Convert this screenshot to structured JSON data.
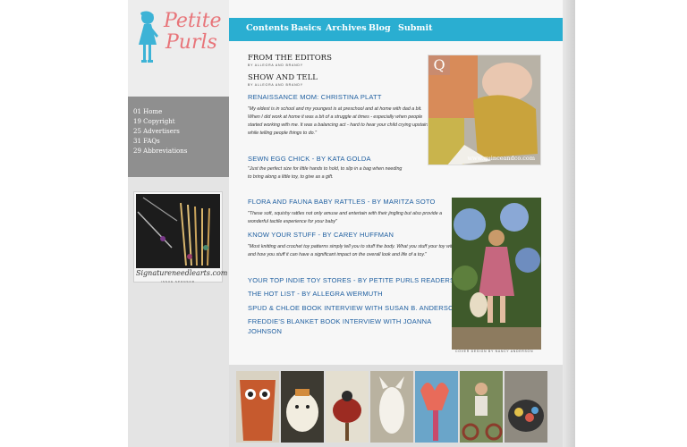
{
  "logo": {
    "line1": "Petite",
    "line2": "Purls"
  },
  "issue_menu": [
    "01 Home",
    "19 Copyright",
    "25 Advertisers",
    "31 FAQs",
    "29 Abbreviations"
  ],
  "sponsor": {
    "site": "Signatureneedlearts.com",
    "tag": "ISSUE SPONSOR"
  },
  "nav": [
    {
      "label": "Contents"
    },
    {
      "label": "Basics"
    },
    {
      "label": "Archives"
    },
    {
      "label": "Blog"
    },
    {
      "label": "Submit"
    }
  ],
  "editors": {
    "title": "FROM THE EDITORS",
    "byline": "BY ALLEGRA AND BRANDY"
  },
  "show_tell": {
    "title": "SHOW AND TELL",
    "byline": "BY ALLEGRA AND BRANDY"
  },
  "articles": [
    {
      "title": "RENAISSANCE MOM: CHRISTINA PLATT",
      "blurb": "\"My eldest is in school and my youngest is at preschool and at home with dad a bit. When I did work at home it was a bit of a struggle at times - especially when people started working with me. It was a balancing act - hard to hear your child crying upstairs while telling people things to do.\""
    },
    {
      "title": "SEWN EGG CHICK - BY KATA GOLDA",
      "blurb": "\"Just the perfect size for little hands to hold, to slip in a bag when needing to bring along a little toy, to give as a gift."
    },
    {
      "title": "FLORA AND FAUNA BABY RATTLES - BY MARITZA SOTO",
      "blurb": "\"These soft, squishy rattles not only amuse and entertain with their jingling but also provide a wonderful tactile experience for your baby\""
    },
    {
      "title": "KNOW YOUR STUFF - BY CAREY HUFFMAN",
      "blurb": "\"Most knitting and crochet toy patterns simply tell you to stuff the body. What you stuff your toy with and how you stuff it can have a significant impact on the overall look and life of a toy.\""
    },
    {
      "title": "YOUR TOP INDIE TOY STORES - BY PETITE PURLS READERS",
      "blurb": ""
    },
    {
      "title": "THE HOT LIST - BY ALLEGRA WERMUTH",
      "blurb": ""
    },
    {
      "title": "SPUD & CHLOE BOOK INTERVIEW WITH SUSAN B. ANDERSON",
      "blurb": ""
    },
    {
      "title": "FREDDIE'S BLANKET BOOK INTERVIEW WITH JOANNA",
      "title2": "JOHNSON",
      "blurb": ""
    }
  ],
  "photo_q": {
    "badge": "Q",
    "url": "www.quinceandco.com"
  },
  "photo_girl": {
    "credit": "COVER DESIGN BY NANCY ANDERSON"
  },
  "colors": {
    "nav": "#2aaed1",
    "link": "#1f5fa0",
    "logo": "#e8757a"
  }
}
